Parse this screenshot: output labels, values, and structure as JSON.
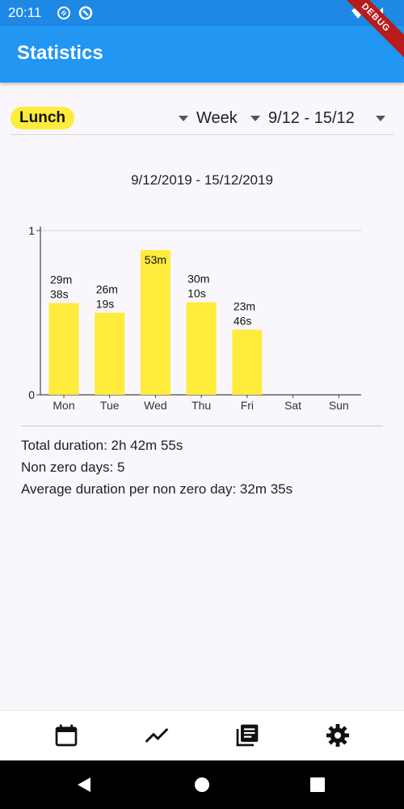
{
  "status_bar": {
    "time": "20:11"
  },
  "app_bar": {
    "title": "Statistics",
    "debug_label": "DEBUG"
  },
  "filters": {
    "category": "Lunch",
    "period": "Week",
    "range": "9/12 - 15/12"
  },
  "chart_title": "9/12/2019 - 15/12/2019",
  "chart_data": {
    "type": "bar",
    "categories": [
      "Mon",
      "Tue",
      "Wed",
      "Thu",
      "Fri",
      "Sat",
      "Sun"
    ],
    "values": [
      0.5588,
      0.4995,
      0.881,
      0.5635,
      0.3965,
      0,
      0
    ],
    "labels": [
      [
        "29m",
        "38s"
      ],
      [
        "26m",
        "19s"
      ],
      [
        "53m"
      ],
      [
        "30m",
        "10s"
      ],
      [
        "23m",
        "46s"
      ],
      [],
      []
    ],
    "ylim": [
      0,
      1
    ],
    "yticks": [
      0,
      1
    ],
    "bar_color": "#ffeb3b"
  },
  "summary": {
    "total": "Total duration: 2h 42m 55s",
    "non_zero_days": "Non zero days: 5",
    "average": "Average duration per non zero day: 32m 35s"
  },
  "bottom_nav": [
    "calendar-icon",
    "trend-icon",
    "library-icon",
    "settings-icon"
  ],
  "colors": {
    "primary": "#2196f3",
    "status_bar": "#1e88e5",
    "accent": "#ffeb3b"
  }
}
